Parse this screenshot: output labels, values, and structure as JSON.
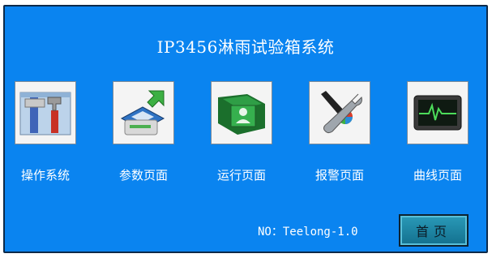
{
  "title": "IP3456淋雨试验箱系统",
  "tiles": [
    {
      "label": "操作系统",
      "icon": "tools-icon"
    },
    {
      "label": "参数页面",
      "icon": "disk-transfer-icon"
    },
    {
      "label": "运行页面",
      "icon": "user-book-icon"
    },
    {
      "label": "报警页面",
      "icon": "brush-wrench-icon"
    },
    {
      "label": "曲线页面",
      "icon": "monitor-curve-icon"
    }
  ],
  "version_text": "NO：Teelong-1.0",
  "home_button": "首页",
  "colors": {
    "background": "#0a84f0",
    "text": "#ffffff",
    "button": "#1f8aa8"
  }
}
